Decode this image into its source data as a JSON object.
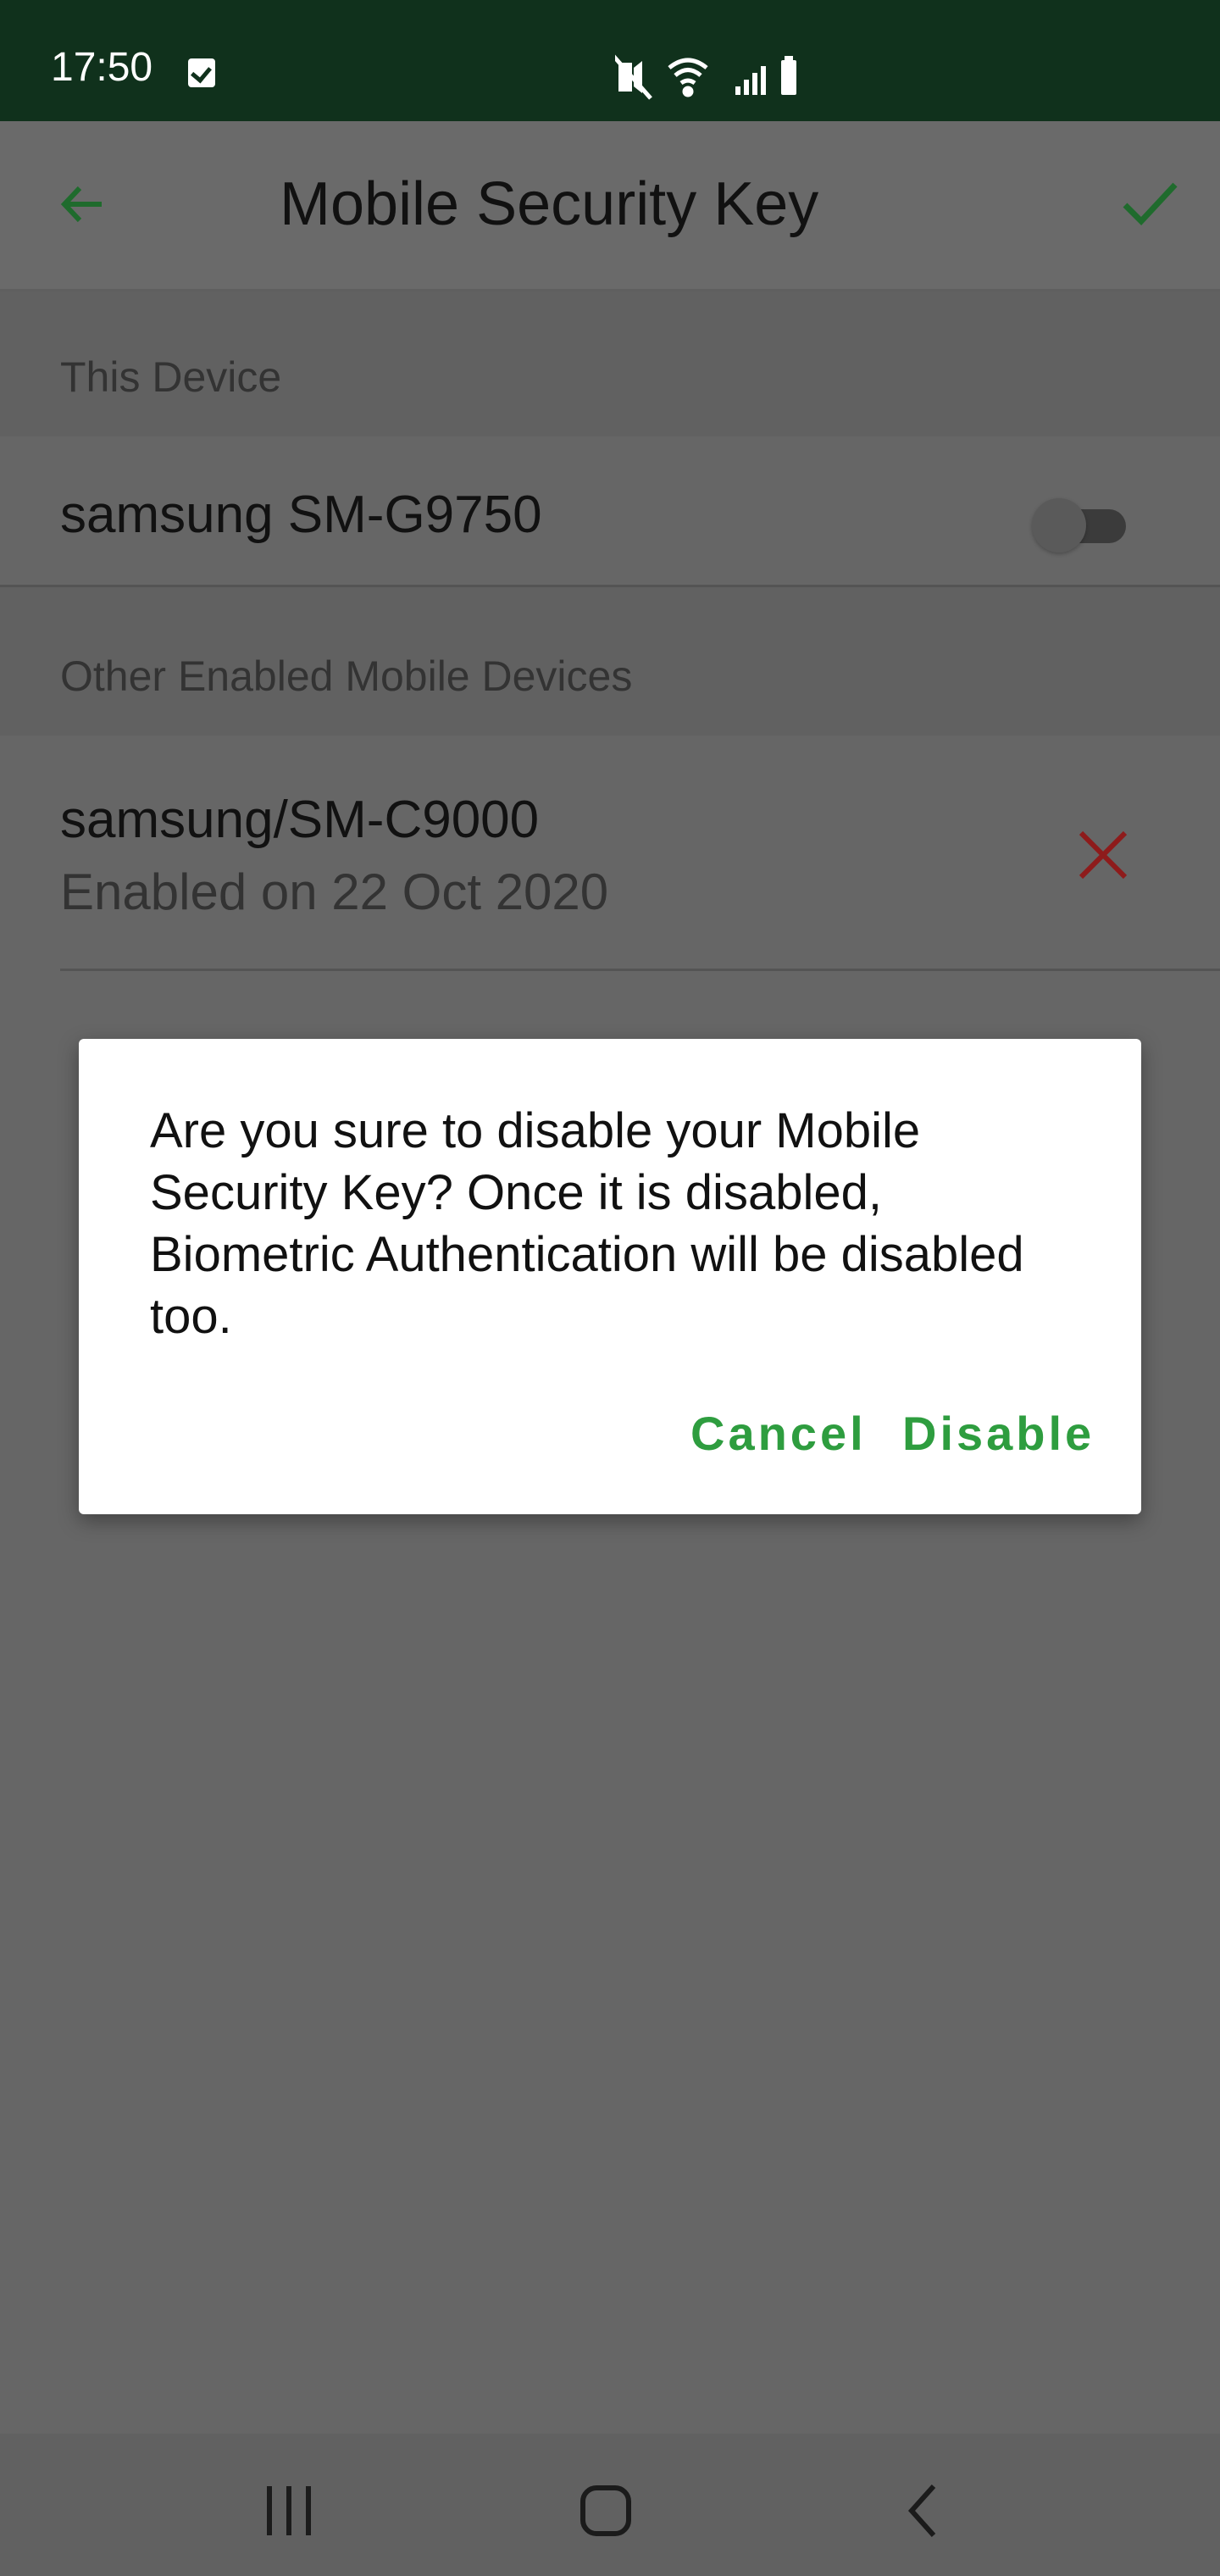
{
  "status_bar": {
    "time": "17:50",
    "icons": [
      "notification-check-icon",
      "vibrate-mute-icon",
      "wifi-icon",
      "signal-icon",
      "battery-icon"
    ]
  },
  "app_bar": {
    "title": "Mobile Security Key",
    "back_icon": "arrow-left-icon",
    "confirm_icon": "check-icon"
  },
  "this_device": {
    "header": "This Device",
    "name": "samsung SM-G9750",
    "toggle_enabled": false
  },
  "other_devices": {
    "header": "Other Enabled Mobile Devices",
    "items": [
      {
        "name": "samsung/SM-C9000",
        "enabled_text": "Enabled on 22 Oct 2020",
        "remove_icon": "close-x-icon"
      }
    ]
  },
  "dialog": {
    "message": "Are you sure to disable your Mobile Security Key? Once it is disabled, Biometric Authentication will be disabled too.",
    "cancel_label": "Cancel",
    "disable_label": "Disable"
  },
  "navigation_bar": {
    "icons": [
      "recent-apps-icon",
      "home-icon",
      "back-icon"
    ]
  },
  "colors": {
    "status_bar": "#10311c",
    "accent": "#2e9d3f",
    "remove": "#8e1b1b",
    "scrim": "#666666"
  }
}
